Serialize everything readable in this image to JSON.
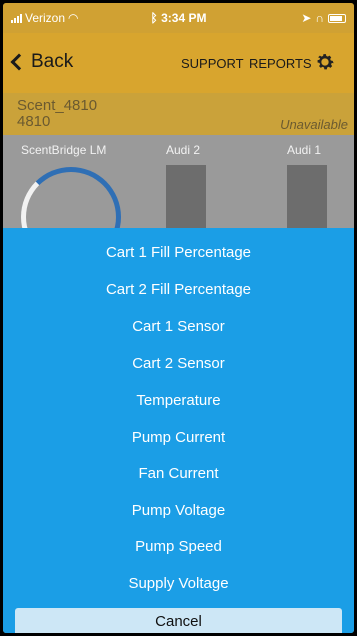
{
  "status_bar": {
    "carrier": "Verizon",
    "time": "3:34 PM"
  },
  "nav": {
    "back_label": "Back",
    "support_label": "SUPPORT",
    "reports_label": "REPORTS"
  },
  "device": {
    "name": "Scent_4810",
    "id": "4810",
    "status": "Unavailable"
  },
  "columns": [
    "ScentBridge LM",
    "Audi 2",
    "Audi 1"
  ],
  "action_sheet": {
    "options": [
      "Cart 1 Fill Percentage",
      "Cart 2 Fill Percentage",
      "Cart 1 Sensor",
      "Cart 2 Sensor",
      "Temperature",
      "Pump Current",
      "Fan Current",
      "Pump Voltage",
      "Pump Speed",
      "Supply Voltage"
    ],
    "cancel_label": "Cancel"
  },
  "colors": {
    "sheet": "#1b9ee6",
    "nav": "#d8a52e"
  }
}
